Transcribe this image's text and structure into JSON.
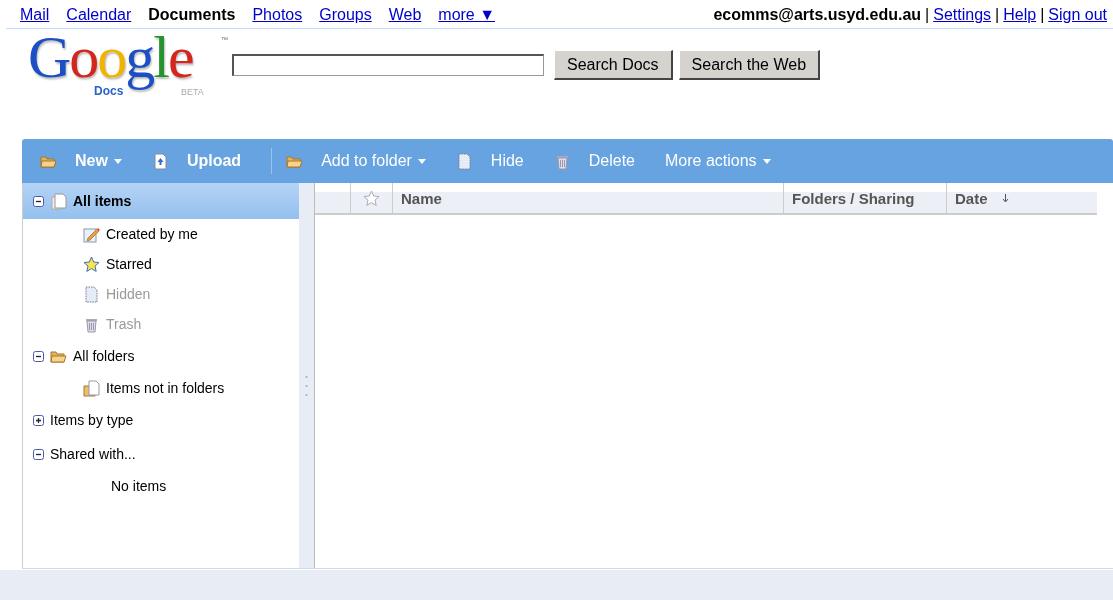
{
  "top_nav": [
    {
      "label": "Mail",
      "selected": false
    },
    {
      "label": "Calendar",
      "selected": false
    },
    {
      "label": "Documents",
      "selected": true
    },
    {
      "label": "Photos",
      "selected": false
    },
    {
      "label": "Groups",
      "selected": false
    },
    {
      "label": "Web",
      "selected": false
    },
    {
      "label": "more ▼",
      "selected": false
    }
  ],
  "account": {
    "email": "ecomms@arts.usyd.edu.au",
    "links": [
      {
        "separator": "|",
        "label": "Settings"
      },
      {
        "separator": "|",
        "label": "Help"
      },
      {
        "separator": "|",
        "label": "Sign out"
      }
    ]
  },
  "logo": {
    "word": "Google",
    "tm": "™",
    "product": "Docs",
    "tag": "BETA"
  },
  "search": {
    "buttons": [
      "Search Docs",
      "Search the Web"
    ]
  },
  "toolbar": [
    {
      "label": "New",
      "kind": "folder",
      "menu": true,
      "bold": true
    },
    {
      "label": "Upload",
      "kind": "upload",
      "menu": false,
      "bold": true
    },
    {
      "label": "Add to folder",
      "kind": "folder",
      "menu": true,
      "bold": false
    },
    {
      "label": "Hide",
      "kind": "hidden",
      "menu": false,
      "bold": false
    },
    {
      "label": "Delete",
      "kind": "trash",
      "menu": false,
      "bold": false
    },
    {
      "label": "More actions",
      "kind": "none",
      "menu": true,
      "bold": false
    }
  ],
  "sidebar": {
    "items": [
      {
        "label": "All items",
        "kind": "pages",
        "expanded": true,
        "selected": true,
        "muted": false,
        "children": [
          {
            "label": "Created by me",
            "kind": "pencil",
            "selected": false,
            "muted": false
          },
          {
            "label": "Starred",
            "kind": "star",
            "selected": false,
            "muted": false
          },
          {
            "label": "Hidden",
            "kind": "hidden",
            "selected": false,
            "muted": true
          },
          {
            "label": "Trash",
            "kind": "trash",
            "selected": false,
            "muted": true
          }
        ]
      },
      {
        "label": "All folders",
        "kind": "folder",
        "expanded": true,
        "selected": false,
        "muted": false,
        "children": [
          {
            "label": "Items not in folders",
            "kind": "folderpage",
            "selected": false,
            "muted": false
          }
        ]
      },
      {
        "label": "Items by type",
        "kind": "none",
        "expanded": false,
        "selected": false,
        "muted": false
      },
      {
        "label": "Shared with...",
        "kind": "none",
        "expanded": true,
        "selected": false,
        "muted": false,
        "children": [
          {
            "label": "No items",
            "kind": "note",
            "selected": false,
            "muted": false
          }
        ]
      }
    ]
  },
  "table": {
    "columns": [
      {
        "label": "Name"
      },
      {
        "label": "Folders / Sharing"
      },
      {
        "label": "Date",
        "sorted": true
      }
    ]
  }
}
